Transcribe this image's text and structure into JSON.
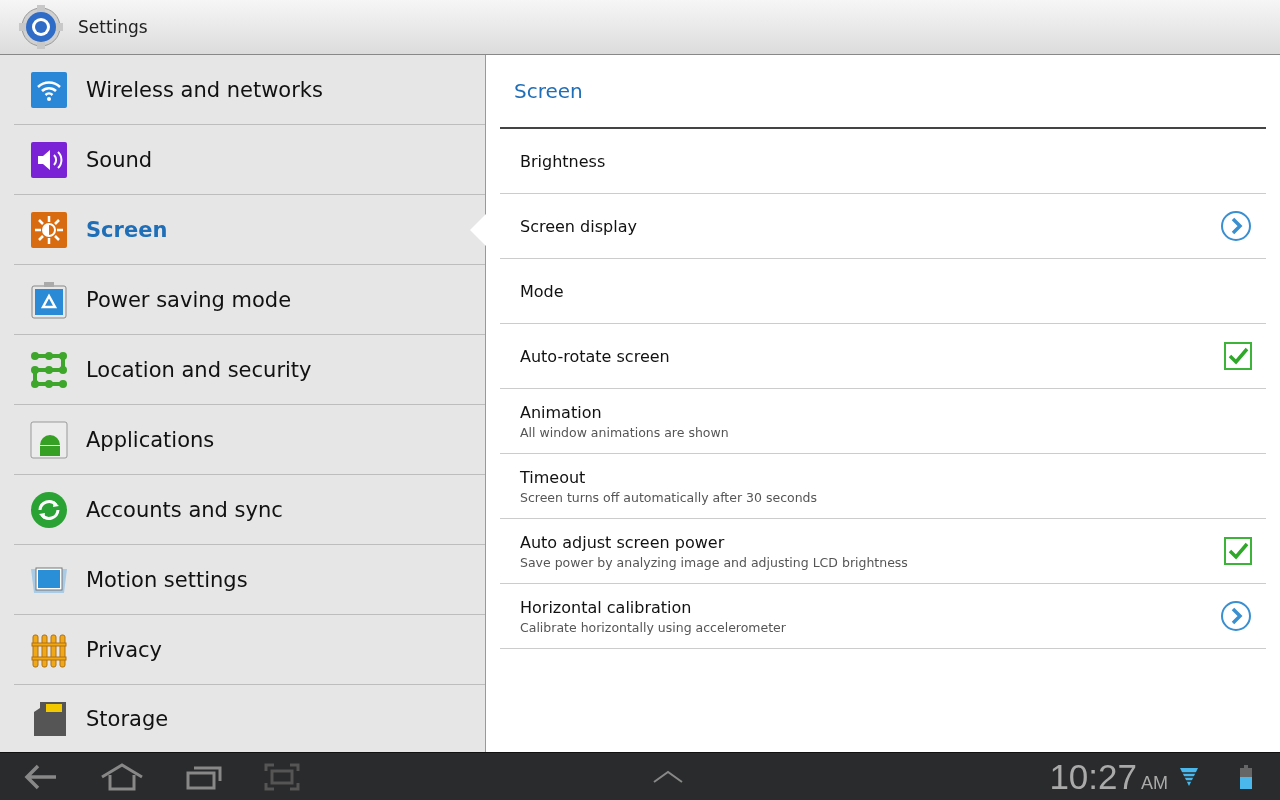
{
  "title_bar": {
    "title": "Settings"
  },
  "sidebar": {
    "items": [
      {
        "label": "Wireless and networks",
        "selected": false
      },
      {
        "label": "Sound",
        "selected": false
      },
      {
        "label": "Screen",
        "selected": true
      },
      {
        "label": "Power saving mode",
        "selected": false
      },
      {
        "label": "Location and security",
        "selected": false
      },
      {
        "label": "Applications",
        "selected": false
      },
      {
        "label": "Accounts and sync",
        "selected": false
      },
      {
        "label": "Motion settings",
        "selected": false
      },
      {
        "label": "Privacy",
        "selected": false
      },
      {
        "label": "Storage",
        "selected": false
      }
    ]
  },
  "panel": {
    "title": "Screen",
    "rows": [
      {
        "kind": "plain",
        "title": "Brightness"
      },
      {
        "kind": "arrow",
        "title": "Screen display"
      },
      {
        "kind": "plain",
        "title": "Mode"
      },
      {
        "kind": "checkbox",
        "title": "Auto-rotate screen",
        "checked": true
      },
      {
        "kind": "plain",
        "title": "Animation",
        "summary": "All window animations are shown"
      },
      {
        "kind": "plain",
        "title": "Timeout",
        "summary": "Screen turns off automatically after 30 seconds"
      },
      {
        "kind": "checkbox",
        "title": "Auto adjust screen power",
        "summary": "Save power by analyzing image and adjusting LCD brightness",
        "checked": true
      },
      {
        "kind": "arrow",
        "title": "Horizontal calibration",
        "summary": "Calibrate horizontally using accelerometer"
      }
    ]
  },
  "status_bar": {
    "time": "10:27",
    "ampm": "AM"
  }
}
